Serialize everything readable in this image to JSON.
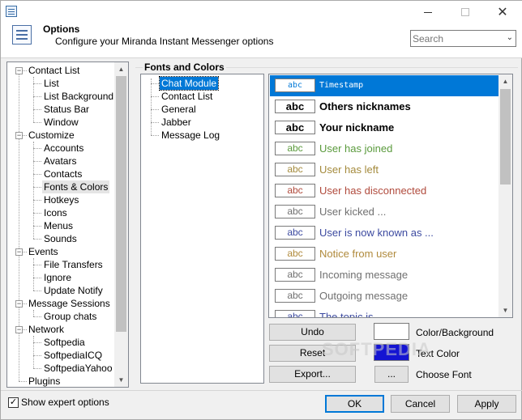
{
  "window": {
    "title": "Options",
    "subtitle": "Configure your Miranda Instant Messenger options",
    "close_glyph": "✕"
  },
  "search": {
    "placeholder": "Search",
    "value": "Search"
  },
  "tree": {
    "items": [
      {
        "label": "Contact List",
        "level": 0,
        "expanded": true
      },
      {
        "label": "List",
        "level": 1
      },
      {
        "label": "List Background",
        "level": 1
      },
      {
        "label": "Status Bar",
        "level": 1
      },
      {
        "label": "Window",
        "level": 1
      },
      {
        "label": "Customize",
        "level": 0,
        "expanded": true
      },
      {
        "label": "Accounts",
        "level": 1
      },
      {
        "label": "Avatars",
        "level": 1
      },
      {
        "label": "Contacts",
        "level": 1
      },
      {
        "label": "Fonts & Colors",
        "level": 1,
        "selected": true
      },
      {
        "label": "Hotkeys",
        "level": 1
      },
      {
        "label": "Icons",
        "level": 1
      },
      {
        "label": "Menus",
        "level": 1
      },
      {
        "label": "Sounds",
        "level": 1
      },
      {
        "label": "Events",
        "level": 0,
        "expanded": true
      },
      {
        "label": "File Transfers",
        "level": 1
      },
      {
        "label": "Ignore",
        "level": 1
      },
      {
        "label": "Update Notify",
        "level": 1
      },
      {
        "label": "Message Sessions",
        "level": 0,
        "expanded": true
      },
      {
        "label": "Group chats",
        "level": 1
      },
      {
        "label": "Network",
        "level": 0,
        "expanded": true
      },
      {
        "label": "Softpedia",
        "level": 1
      },
      {
        "label": "SoftpediaICQ",
        "level": 1
      },
      {
        "label": "SoftpediaYahoo",
        "level": 1
      },
      {
        "label": "Plugins",
        "level": 0
      }
    ]
  },
  "fonts_panel": {
    "group_title": "Fonts and Colors",
    "categories": [
      {
        "label": "Chat Module",
        "selected": true
      },
      {
        "label": "Contact List"
      },
      {
        "label": "General"
      },
      {
        "label": "Jabber"
      },
      {
        "label": "Message Log"
      }
    ],
    "preview_sample": "abc",
    "fonts": [
      {
        "label": "Timestamp",
        "color": "#ffffff",
        "bold": false,
        "mono": true,
        "selected": true
      },
      {
        "label": "Others nicknames",
        "color": "#000000",
        "bold": true
      },
      {
        "label": "Your nickname",
        "color": "#000000",
        "bold": true
      },
      {
        "label": "User has joined",
        "color": "#5a9a3c",
        "bold": false
      },
      {
        "label": "User has left",
        "color": "#a48a3c",
        "bold": false
      },
      {
        "label": "User has disconnected",
        "color": "#b04a3c",
        "bold": false
      },
      {
        "label": "User kicked ...",
        "color": "#707070",
        "bold": false
      },
      {
        "label": "User is now known as ...",
        "color": "#3c4aa0",
        "bold": false
      },
      {
        "label": "Notice from user",
        "color": "#b08a3c",
        "bold": false
      },
      {
        "label": "Incoming message",
        "color": "#707070",
        "bold": false
      },
      {
        "label": "Outgoing message",
        "color": "#707070",
        "bold": false
      },
      {
        "label": "The topic is ...",
        "color": "#3c4aa0",
        "bold": false
      }
    ],
    "undo_label": "Undo",
    "reset_label": "Reset",
    "export_label": "Export...",
    "ellipsis_label": "...",
    "color_background_label": "Color/Background",
    "text_color_label": "Text Color",
    "choose_font_label": "Choose Font",
    "background_color": "#ffffff",
    "text_color": "#1414d2"
  },
  "footer": {
    "expert_label": "Show expert options",
    "expert_checked": true,
    "ok_label": "OK",
    "cancel_label": "Cancel",
    "apply_label": "Apply"
  },
  "watermark": "SOFTPEDIA"
}
